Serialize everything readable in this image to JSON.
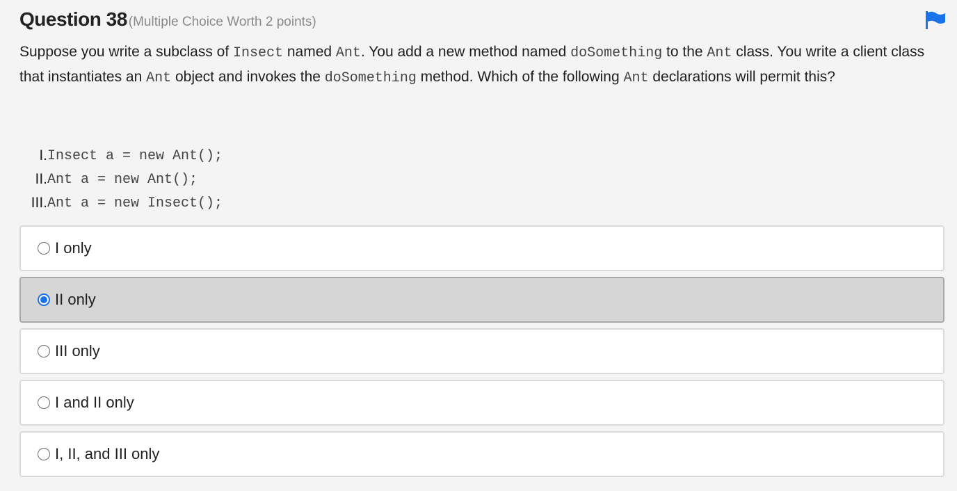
{
  "question": {
    "title": "Question 38",
    "worth": "(Multiple Choice Worth 2 points)",
    "flag_icon": "flag-icon",
    "prompt": [
      {
        "t": "text",
        "v": "Suppose you write a subclass of "
      },
      {
        "t": "code",
        "v": "Insect"
      },
      {
        "t": "text",
        "v": " named "
      },
      {
        "t": "code",
        "v": "Ant"
      },
      {
        "t": "text",
        "v": ". You add a new method named "
      },
      {
        "t": "code",
        "v": "doSomething"
      },
      {
        "t": "text",
        "v": " to the "
      },
      {
        "t": "code",
        "v": "Ant"
      },
      {
        "t": "text",
        "v": " class. You write a client class that instantiates an "
      },
      {
        "t": "code",
        "v": "Ant"
      },
      {
        "t": "text",
        "v": " object and invokes the "
      },
      {
        "t": "code",
        "v": "doSomething"
      },
      {
        "t": "text",
        "v": " method. Which of the following "
      },
      {
        "t": "code",
        "v": "Ant"
      },
      {
        "t": "text",
        "v": " declarations will permit this?"
      }
    ],
    "statements": [
      {
        "num": "I.",
        "code": "Insect a = new Ant();"
      },
      {
        "num": "II.",
        "code": "Ant a = new Ant();"
      },
      {
        "num": "III.",
        "code": "Ant a = new Insect();"
      }
    ],
    "options": [
      {
        "label": "I only",
        "selected": false
      },
      {
        "label": "II only",
        "selected": true
      },
      {
        "label": "III only",
        "selected": false
      },
      {
        "label": "I and II only",
        "selected": false
      },
      {
        "label": "I, II, and III only",
        "selected": false
      }
    ]
  },
  "colors": {
    "accent": "#1a73e8",
    "selected_bg": "#d6d6d6",
    "page_bg": "#f4f4f4"
  }
}
